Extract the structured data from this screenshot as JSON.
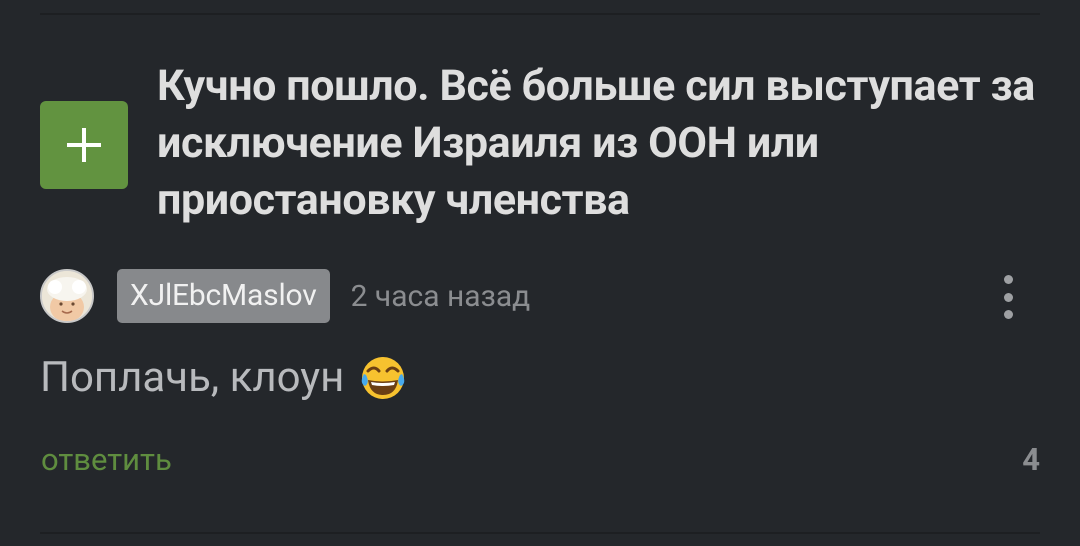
{
  "story": {
    "title": "Кучно пошло. Всё больше сил выступает за исключение Израиля из ООН или приостановку членства"
  },
  "comment": {
    "username": "XJlEbcMaslov",
    "time": "2 часа назад",
    "text": "Поплачь, клоун",
    "emoji_icon": "face-with-tears-of-joy",
    "reply_label": "ответить",
    "rating": "4"
  },
  "colors": {
    "background": "#24272b",
    "accent_green": "#629340",
    "reply_green": "#5f8d3f",
    "username_badge": "#87898c"
  }
}
